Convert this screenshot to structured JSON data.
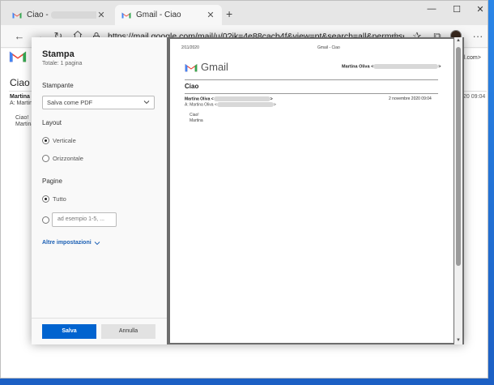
{
  "browser": {
    "tabs": [
      {
        "label": "Ciao -",
        "active": false
      },
      {
        "label": "Gmail - Ciao",
        "active": true
      }
    ],
    "url": "https://mail.google.com/mail/u/0?ik=4e88cacb4f&view=pt&search=all&permmsgid..."
  },
  "background_page": {
    "subject": "Ciao",
    "from": "Martina",
    "to": "A: Martin",
    "body_line1": "Ciao!",
    "body_line2": "Martina",
    "right_top": "l.com>",
    "right_time": "20 09:04"
  },
  "print_panel": {
    "title": "Stampa",
    "total": "Totale: 1 pagina",
    "printer_label": "Stampante",
    "printer_value": "Salva come PDF",
    "layout_label": "Layout",
    "layout_options": [
      {
        "label": "Verticale",
        "selected": true
      },
      {
        "label": "Orizzontale",
        "selected": false
      }
    ],
    "pages_label": "Pagine",
    "pages_all": "Tutto",
    "pages_placeholder": "ad esempio 1-5, ...",
    "more_settings": "Altre impostazioni",
    "save_label": "Salva",
    "cancel_label": "Annulla"
  },
  "preview": {
    "header_date": "2/11/2020",
    "header_title": "Gmail - Ciao",
    "logo_text": "Gmail",
    "sender_top": "Martina Oliva <",
    "subject": "Ciao",
    "from": "Martina Oliva <",
    "date": "2 novembre 2020 09:04",
    "to": "A: Martina Oliva <",
    "body_line1": "Ciao!",
    "body_line2": "Martina"
  }
}
